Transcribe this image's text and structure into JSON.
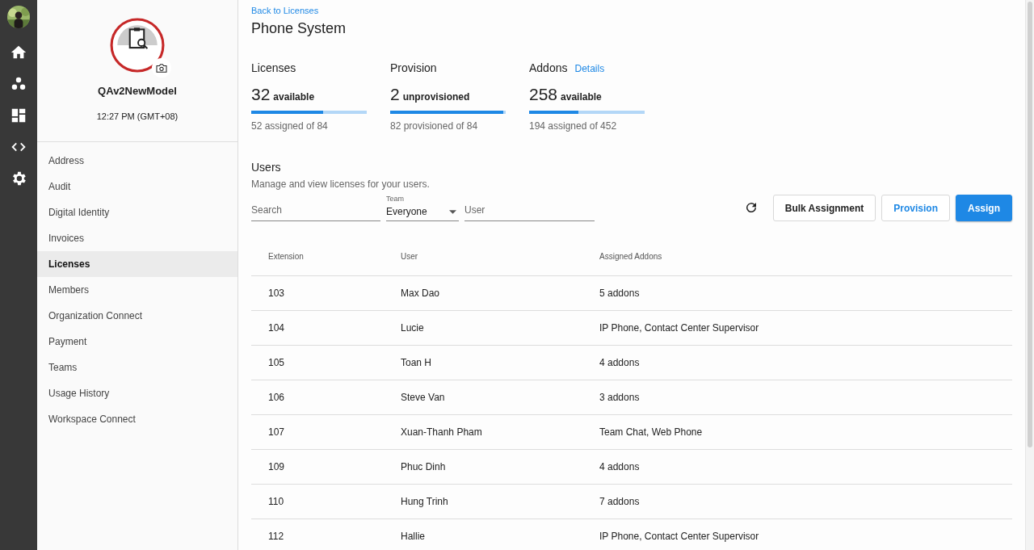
{
  "rail": {
    "items": [
      {
        "kind": "home"
      },
      {
        "kind": "people"
      },
      {
        "kind": "dashboard"
      },
      {
        "kind": "code"
      },
      {
        "kind": "settings"
      }
    ]
  },
  "profile": {
    "name": "QAv2NewModel",
    "time": "12:27 PM (GMT+08)"
  },
  "sidebar": {
    "items": [
      {
        "label": "Address",
        "selected": false
      },
      {
        "label": "Audit",
        "selected": false
      },
      {
        "label": "Digital Identity",
        "selected": false
      },
      {
        "label": "Invoices",
        "selected": false
      },
      {
        "label": "Licenses",
        "selected": true
      },
      {
        "label": "Members",
        "selected": false
      },
      {
        "label": "Organization Connect",
        "selected": false
      },
      {
        "label": "Payment",
        "selected": false
      },
      {
        "label": "Teams",
        "selected": false
      },
      {
        "label": "Usage History",
        "selected": false
      },
      {
        "label": "Workspace Connect",
        "selected": false
      }
    ]
  },
  "back_link": "Back to Licenses",
  "title": "Phone System",
  "stats": [
    {
      "label": "Licenses",
      "number": "32",
      "unit": "available",
      "level": 0.62,
      "detail": "52 assigned of 84"
    },
    {
      "label": "Provision",
      "number": "2",
      "unit": "unprovisioned",
      "level": 0.976,
      "detail": "82 provisioned of 84"
    },
    {
      "label": "Addons",
      "link": "Details",
      "number": "258",
      "unit": "available",
      "level": 0.43,
      "detail": "194 assigned of 452"
    }
  ],
  "users": {
    "heading": "Users",
    "description": "Manage and view licenses for your users.",
    "search": {
      "placeholder": "Search"
    },
    "team": {
      "label": "Team",
      "value": "Everyone"
    },
    "user": {
      "placeholder": "User"
    },
    "buttons": [
      {
        "label": "Bulk Assignment",
        "kind": "outlined"
      },
      {
        "label": "Provision",
        "kind": "outlined-primary"
      },
      {
        "label": "Assign",
        "kind": "primary"
      }
    ]
  },
  "table": {
    "columns": [
      "Extension",
      "User",
      "Assigned Addons"
    ],
    "rows": [
      [
        "103",
        "Max Dao",
        "5 addons"
      ],
      [
        "104",
        "Lucie",
        "IP Phone, Contact Center Supervisor"
      ],
      [
        "105",
        "Toan H",
        "4 addons"
      ],
      [
        "106",
        "Steve Van",
        "3 addons"
      ],
      [
        "107",
        "Xuan-Thanh Pham",
        "Team Chat, Web Phone"
      ],
      [
        "109",
        "Phuc Dinh",
        "4 addons"
      ],
      [
        "110",
        "Hung Trinh",
        "7 addons"
      ],
      [
        "112",
        "Hallie",
        "IP Phone, Contact Center Supervisor"
      ]
    ]
  }
}
